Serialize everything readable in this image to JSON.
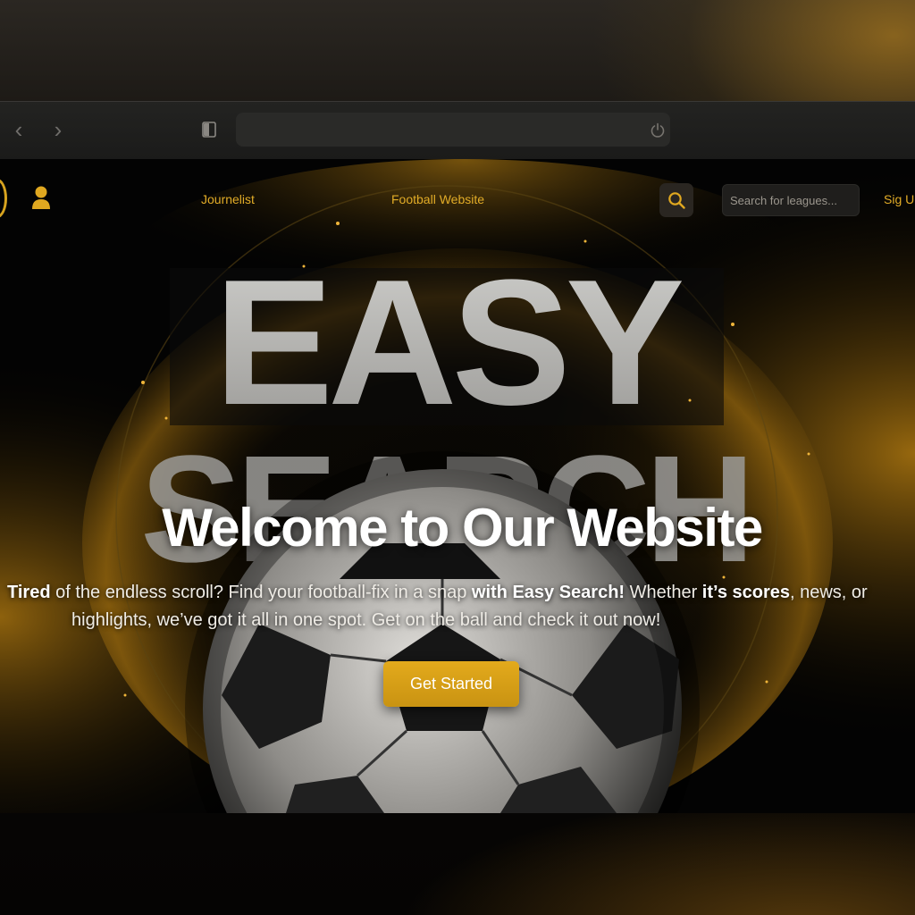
{
  "browser": {
    "back_glyph": "‹",
    "forward_glyph": "›",
    "address_value": "",
    "icons": [
      "back-arrow-icon",
      "forward-arrow-icon",
      "shield-icon",
      "reload-icon"
    ]
  },
  "nav": {
    "links": [
      {
        "label": "Journelist"
      },
      {
        "label": "Football Website"
      }
    ],
    "signup_label": "Sig U",
    "search_placeholder": "Search for leagues...",
    "icons": [
      "logo-ball-icon",
      "user-icon",
      "search-icon"
    ]
  },
  "hero": {
    "backdrop_word1": "EASY",
    "backdrop_word2": "SEARCH",
    "title": "Welcome to Our Website",
    "desc_line1": {
      "p1": "Tired",
      "p2": " of the endless scroll? Find your football-fix in a snap ",
      "p3": "with Easy Search!",
      "p4": " Whether ",
      "p5": "it’s scores",
      "p6": ", news, or"
    },
    "desc_line2": "highlights, we’ve got it all in one spot. Get on the ball and check it out now!",
    "cta_label": "Get Started"
  },
  "colors": {
    "accent": "#E0A820",
    "background": "#030303",
    "text": "#FFFFFF"
  }
}
